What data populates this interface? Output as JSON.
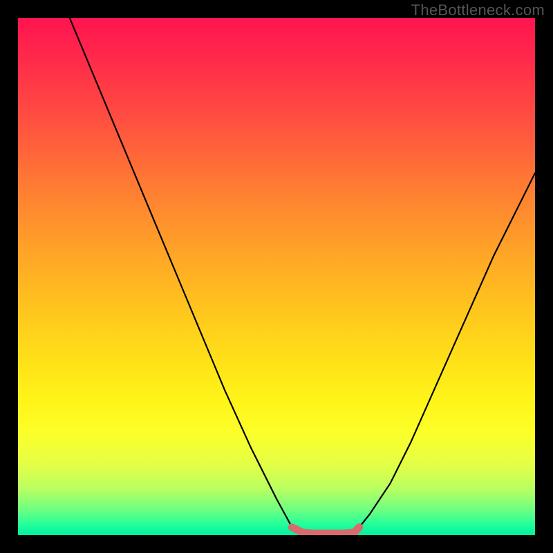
{
  "watermark": "TheBottleneck.com",
  "chart_data": {
    "type": "line",
    "title": "",
    "xlabel": "",
    "ylabel": "",
    "xlim": [
      0,
      100
    ],
    "ylim": [
      0,
      100
    ],
    "grid": false,
    "legend": false,
    "series": [
      {
        "name": "left-curve",
        "x": [
          10,
          15,
          20,
          25,
          30,
          35,
          40,
          45,
          50,
          53,
          55
        ],
        "y": [
          100,
          88,
          76,
          64,
          52,
          40,
          28,
          17,
          7,
          1.5,
          0.5
        ]
      },
      {
        "name": "right-curve",
        "x": [
          64,
          66,
          68,
          72,
          76,
          80,
          84,
          88,
          92,
          96,
          100
        ],
        "y": [
          0.5,
          1.5,
          4,
          10,
          18,
          27,
          36,
          45,
          54,
          62,
          70
        ]
      },
      {
        "name": "optimal-zone-marker",
        "x": [
          53,
          55,
          57,
          59,
          61,
          63,
          65,
          66
        ],
        "y": [
          1.5,
          0.5,
          0.3,
          0.3,
          0.3,
          0.3,
          0.5,
          1.5
        ]
      }
    ],
    "colors": {
      "curve": "#000000",
      "marker": "#d86b6b"
    }
  }
}
